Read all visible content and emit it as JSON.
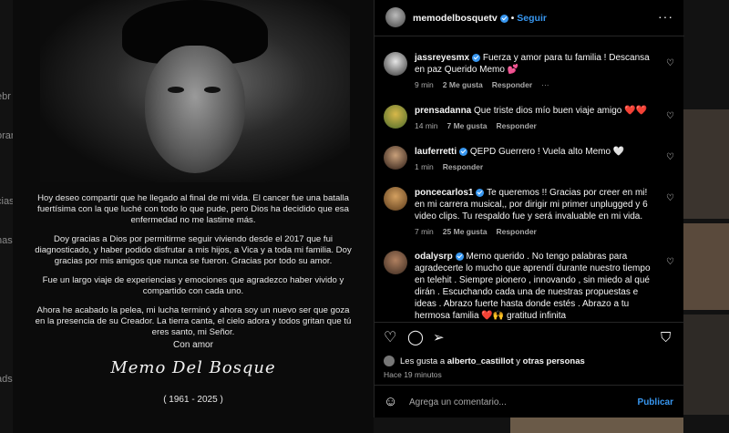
{
  "background": {
    "side_labels": [
      "ebr",
      "orar",
      "",
      "cias",
      "nas",
      "ads"
    ]
  },
  "post_image": {
    "paragraphs": [
      "Hoy deseo compartir que he llegado al final de mi vida. El cancer fue una batalla fuertísima con la que luché con todo lo que pude, pero Dios ha decidido que esa enfermedad no me lastime más.",
      "Doy gracias a Dios por permitirme seguir viviendo desde el 2017 que fui diagnosticado, y haber podido disfrutar a mis hijos, a Vica y a toda mi familia. Doy gracias por mis amigos que nunca se fueron. Gracias por todo su amor.",
      "Fue un largo viaje de experiencias y emociones que agradezco haber vivido y compartido con cada uno.",
      "Ahora he acabado la pelea, mi lucha terminó y ahora soy un nuevo ser que goza en la presencia de su Creador. La tierra canta, el cielo adora y todos gritan que tú eres santo, mi Señor."
    ],
    "closing": "Con amor",
    "signature": "Memo Del Bosque",
    "years": "( 1961 - 2025 )"
  },
  "header": {
    "username": "memodelbosquetv",
    "separator": "•",
    "follow_label": "Seguir",
    "more_label": "···"
  },
  "comments": [
    {
      "username": "jassreyesmx",
      "verified": true,
      "text": "Fuerza y amor para tu familia ! Descansa en paz Querido Memo 💕",
      "time": "9 min",
      "likes": "2 Me gusta",
      "reply": "Responder",
      "more": "···"
    },
    {
      "username": "prensadanna",
      "verified": false,
      "text": "Que triste dios mío buen viaje amigo ❤️❤️",
      "time": "14 min",
      "likes": "7 Me gusta",
      "reply": "Responder"
    },
    {
      "username": "lauferretti",
      "verified": true,
      "text": "QEPD Guerrero ! Vuela alto Memo 🤍",
      "time": "1 min",
      "reply": "Responder"
    },
    {
      "username": "poncecarlos1",
      "verified": true,
      "text": "Te queremos !! Gracias por creer en mi! en mi carrera musical,, por dirigir mi primer unplugged y 6 video clips. Tu respaldo fue y será invaluable en mi vida.",
      "time": "7 min",
      "likes": "25 Me gusta",
      "reply": "Responder"
    },
    {
      "username": "odalysrp",
      "verified": true,
      "text": "Memo querido . No tengo palabras para agradecerte lo mucho que aprendí durante nuestro tiempo en telehit . Siempre pionero , innovando , sin miedo al qué dirán . Escuchando cada una de nuestras propuestas e ideas . Abrazo fuerte hasta donde estés . Abrazo a tu hermosa familia ❤️🙌 gratitud infinita"
    }
  ],
  "actions": {
    "like_icon": "heart-icon",
    "comment_icon": "comment-icon",
    "share_icon": "share-icon",
    "save_icon": "bookmark-icon",
    "likes_prefix": "Les gusta a",
    "likes_user": "alberto_castillot",
    "likes_and": "y",
    "likes_others": "otras personas",
    "time_ago": "Hace 19 minutos"
  },
  "add_comment": {
    "placeholder": "Agrega un comentario...",
    "publish_label": "Publicar"
  },
  "colors": {
    "accent": "#3897f0",
    "heart_red": "#ed4956"
  }
}
